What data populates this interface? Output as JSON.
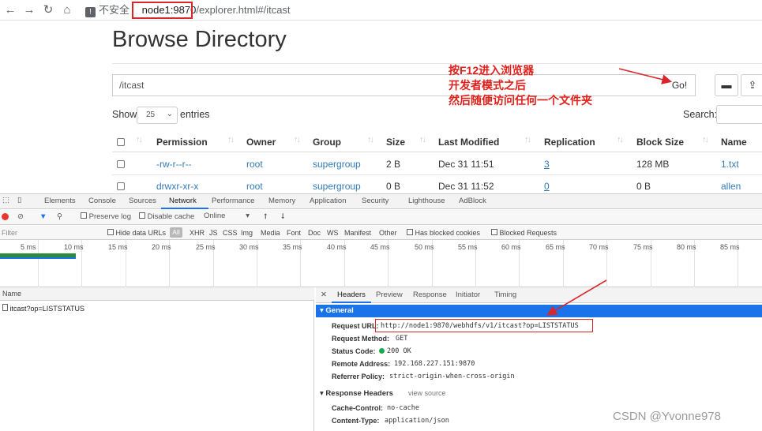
{
  "browser": {
    "insecure_label": "不安全",
    "url_host": "node1:9870",
    "url_rest": "/explorer.html#/itcast"
  },
  "page": {
    "title": "Browse Directory",
    "path_value": "/itcast",
    "go_label": "Go!",
    "show_label": "Show",
    "show_value": "25",
    "entries_label": "entries",
    "search_label": "Search:"
  },
  "table": {
    "columns": [
      "Permission",
      "Owner",
      "Group",
      "Size",
      "Last Modified",
      "Replication",
      "Block Size",
      "Name"
    ],
    "rows": [
      {
        "permission": "-rw-r--r--",
        "owner": "root",
        "group": "supergroup",
        "size": "2 B",
        "modified": "Dec 31 11:51",
        "replication": "3",
        "block": "128 MB",
        "name": "1.txt"
      },
      {
        "permission": "drwxr-xr-x",
        "owner": "root",
        "group": "supergroup",
        "size": "0 B",
        "modified": "Dec 31 11:52",
        "replication": "0",
        "block": "0 B",
        "name": "allen"
      }
    ]
  },
  "annotation": "按F12进入浏览器\n开发者模式之后\n然后随便访问任何一个文件夹",
  "devtools": {
    "tabs": [
      "Elements",
      "Console",
      "Sources",
      "Network",
      "Performance",
      "Memory",
      "Application",
      "Security",
      "Lighthouse",
      "AdBlock"
    ],
    "toolbar": {
      "preserve_log": "Preserve log",
      "disable_cache": "Disable cache",
      "throttle": "Online"
    },
    "filter": {
      "placeholder": "Filter",
      "hide_data_urls": "Hide data URLs",
      "all": "All",
      "types": [
        "XHR",
        "JS",
        "CSS",
        "Img",
        "Media",
        "Font",
        "Doc",
        "WS",
        "Manifest",
        "Other"
      ],
      "blocked_cookies": "Has blocked cookies",
      "blocked_requests": "Blocked Requests"
    },
    "timeline_ticks": [
      "5 ms",
      "10 ms",
      "15 ms",
      "20 ms",
      "25 ms",
      "30 ms",
      "35 ms",
      "40 ms",
      "45 ms",
      "50 ms",
      "55 ms",
      "60 ms",
      "65 ms",
      "70 ms",
      "75 ms",
      "80 ms",
      "85 ms"
    ],
    "list_header": "Name",
    "request_name": "itcast?op=LISTSTATUS",
    "detail_tabs": [
      "Headers",
      "Preview",
      "Response",
      "Initiator",
      "Timing"
    ],
    "general_label": "General",
    "general": {
      "request_url_k": "Request URL:",
      "request_url_v": "http://node1:9870/webhdfs/v1/itcast?op=LISTSTATUS",
      "method_k": "Request Method:",
      "method_v": "GET",
      "status_k": "Status Code:",
      "status_v": "200 OK",
      "remote_k": "Remote Address:",
      "remote_v": "192.168.227.151:9870",
      "referrer_k": "Referrer Policy:",
      "referrer_v": "strict-origin-when-cross-origin"
    },
    "response_headers_label": "Response Headers",
    "view_source": "view source",
    "response": {
      "cache_k": "Cache-Control:",
      "cache_v": "no-cache",
      "ctype_k": "Content-Type:",
      "ctype_v": "application/json"
    }
  },
  "watermark": "CSDN @Yvonne978",
  "colors": {
    "accent_red": "#d9262b",
    "link_blue": "#337ab7",
    "devtools_blue": "#1a73e8"
  }
}
